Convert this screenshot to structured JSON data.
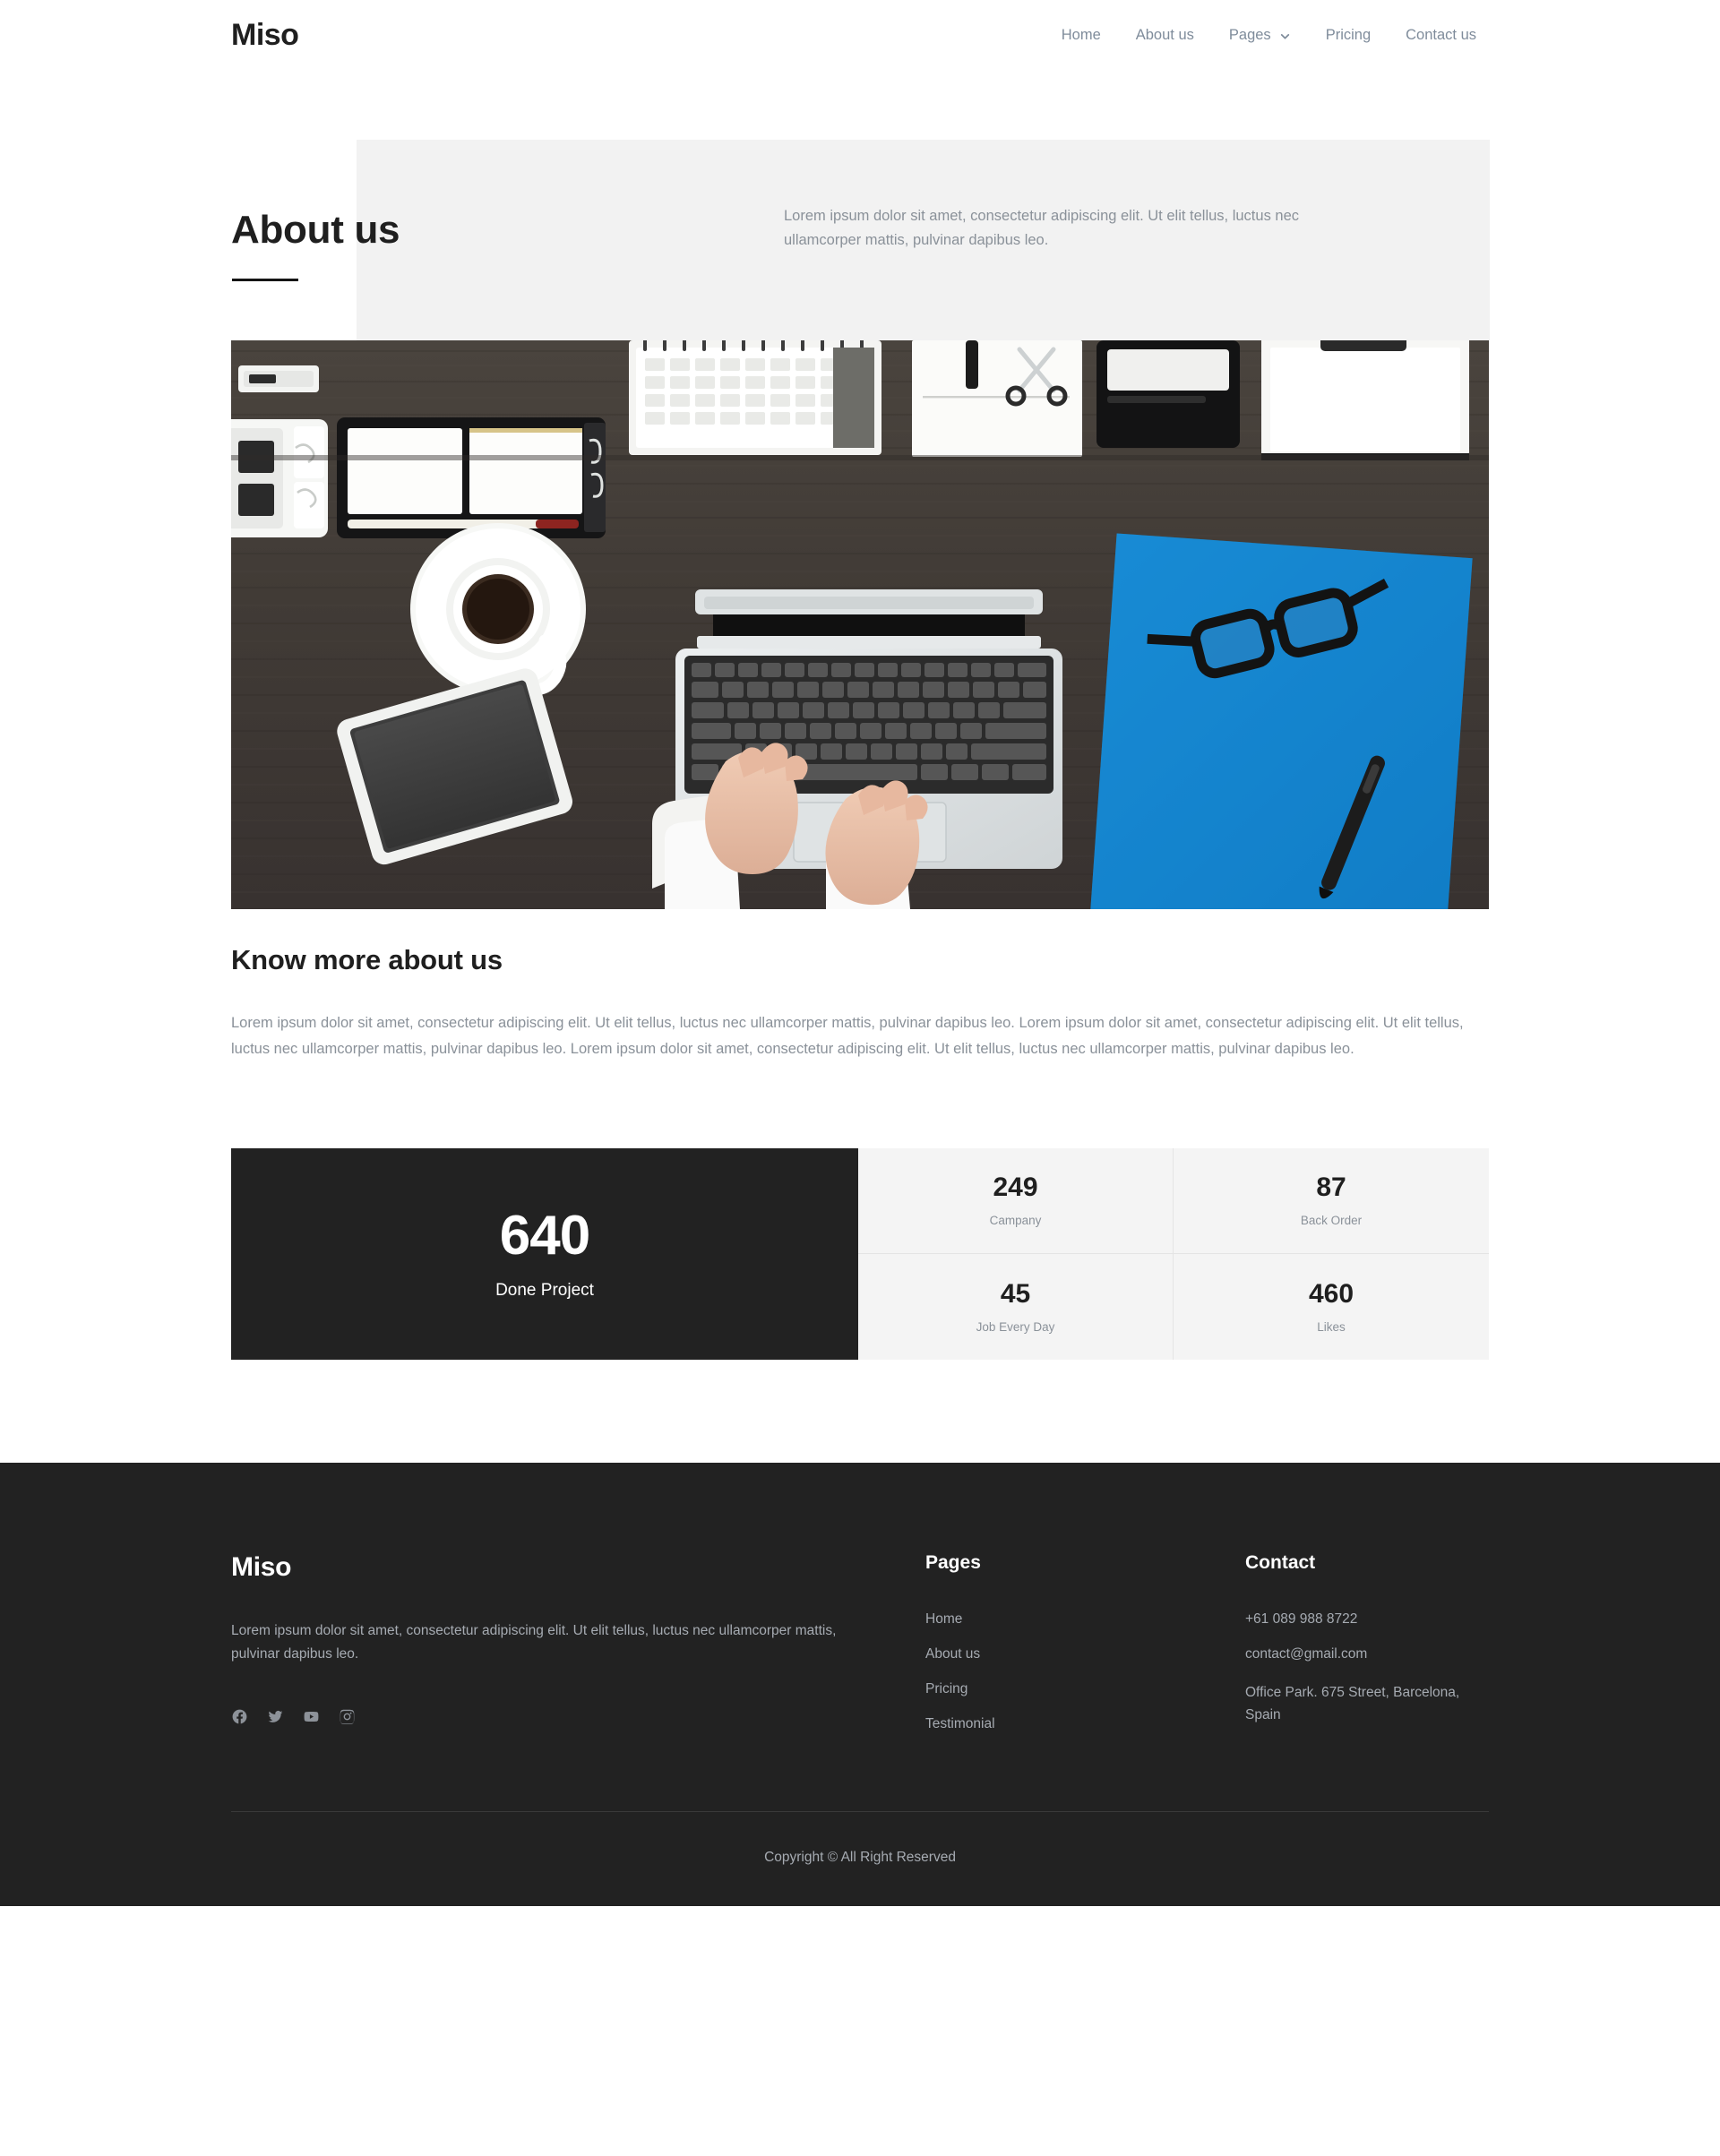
{
  "header": {
    "brand": "Miso",
    "nav": [
      {
        "label": "Home",
        "has_dropdown": false
      },
      {
        "label": "About us",
        "has_dropdown": false
      },
      {
        "label": "Pages",
        "has_dropdown": true
      },
      {
        "label": "Pricing",
        "has_dropdown": false
      },
      {
        "label": "Contact us",
        "has_dropdown": false
      }
    ]
  },
  "hero": {
    "title": "About us",
    "text": "Lorem ipsum dolor sit amet, consectetur adipiscing elit. Ut elit tellus, luctus nec ullamcorper mattis, pulvinar dapibus leo.",
    "panel_color": "#f2f2f2"
  },
  "feature_image": {
    "alt": "Desk flat lay with laptop, hands typing, coffee cup, tablet, blue notebook, glasses and pen on dark wood desk"
  },
  "know_more": {
    "heading": "Know more about us",
    "body": "Lorem ipsum dolor sit amet, consectetur adipiscing elit. Ut elit tellus, luctus nec ullamcorper mattis, pulvinar dapibus leo. Lorem ipsum dolor sit amet, consectetur adipiscing elit. Ut elit tellus, luctus nec ullamcorper mattis, pulvinar dapibus leo. Lorem ipsum dolor sit amet, consectetur adipiscing elit. Ut elit tellus, luctus nec ullamcorper mattis, pulvinar dapibus leo."
  },
  "stats": {
    "featured": {
      "value": "640",
      "label": "Done Project"
    },
    "cells": [
      {
        "value": "249",
        "label": "Campany"
      },
      {
        "value": "87",
        "label": "Back Order"
      },
      {
        "value": "45",
        "label": "Job Every Day"
      },
      {
        "value": "460",
        "label": "Likes"
      }
    ]
  },
  "footer": {
    "brand": "Miso",
    "about": "Lorem ipsum dolor sit amet, consectetur adipiscing elit. Ut elit tellus, luctus nec ullamcorper mattis, pulvinar dapibus leo.",
    "socials": [
      {
        "name": "facebook-icon"
      },
      {
        "name": "twitter-icon"
      },
      {
        "name": "youtube-icon"
      },
      {
        "name": "instagram-icon"
      }
    ],
    "pages": {
      "title": "Pages",
      "links": [
        "Home",
        "About us",
        "Pricing",
        "Testimonial"
      ]
    },
    "contact": {
      "title": "Contact",
      "phone": "+61 089 988 8722",
      "email": "contact@gmail.com",
      "address": "Office Park. 675 Street, Barcelona, Spain"
    },
    "copyright": "Copyright © All Right Reserved",
    "background_color": "#222222"
  }
}
